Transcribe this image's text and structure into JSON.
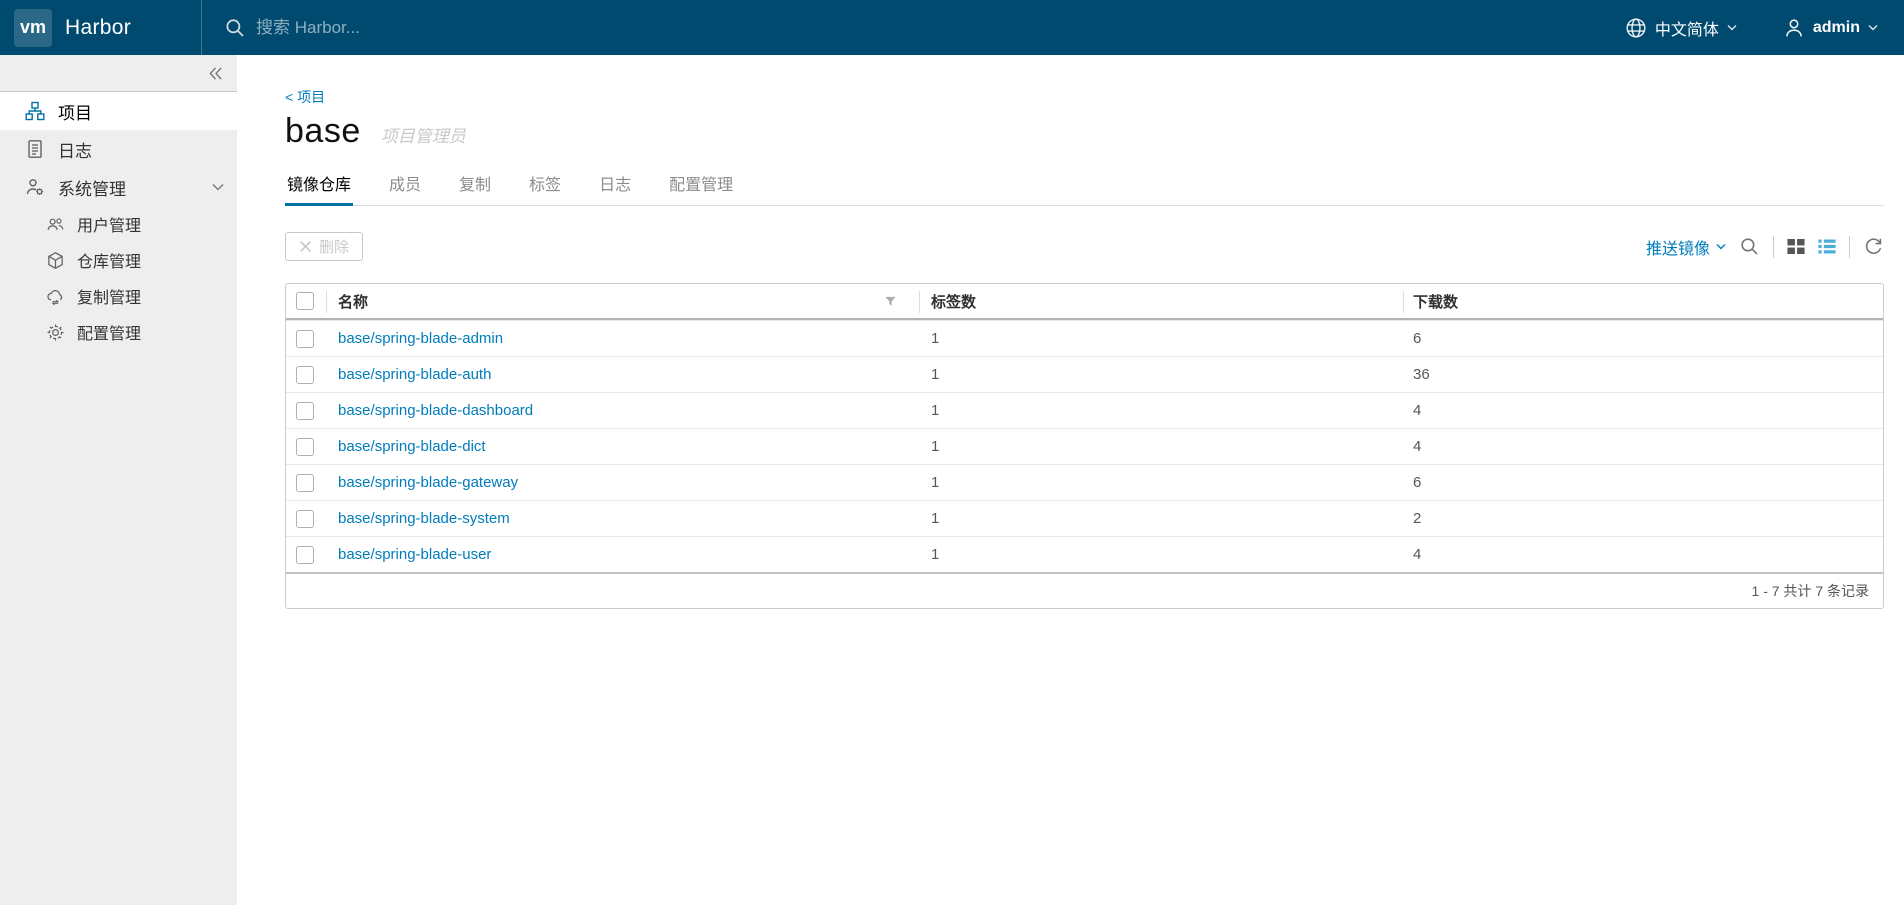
{
  "nav": {
    "logo_text": "vm",
    "brand": "Harbor",
    "search_placeholder": "搜索 Harbor...",
    "language": "中文简体",
    "username": "admin"
  },
  "sidebar": {
    "items": [
      {
        "label": "项目",
        "icon": "organization-icon",
        "active": true
      },
      {
        "label": "日志",
        "icon": "log-list-icon",
        "active": false
      },
      {
        "label": "系统管理",
        "icon": "administrator-icon",
        "active": false,
        "expanded": true
      }
    ],
    "subitems": [
      {
        "label": "用户管理",
        "icon": "users-icon"
      },
      {
        "label": "仓库管理",
        "icon": "cube-icon"
      },
      {
        "label": "复制管理",
        "icon": "replication-cloud-icon"
      },
      {
        "label": "配置管理",
        "icon": "gear-icon"
      }
    ]
  },
  "main": {
    "breadcrumb": "< 项目",
    "title": "base",
    "role_badge": "项目管理员",
    "tabs": [
      {
        "label": "镜像仓库",
        "active": true
      },
      {
        "label": "成员",
        "active": false
      },
      {
        "label": "复制",
        "active": false
      },
      {
        "label": "标签",
        "active": false
      },
      {
        "label": "日志",
        "active": false
      },
      {
        "label": "配置管理",
        "active": false
      }
    ],
    "toolbar": {
      "delete_label": "删除",
      "push_image_label": "推送镜像",
      "icons": [
        "search-icon",
        "grid-view-icon",
        "list-view-icon",
        "refresh-icon"
      ]
    },
    "table": {
      "columns": [
        "名称",
        "标签数",
        "下载数"
      ],
      "rows": [
        {
          "name": "base/spring-blade-admin",
          "tags": "1",
          "downloads": "6"
        },
        {
          "name": "base/spring-blade-auth",
          "tags": "1",
          "downloads": "36"
        },
        {
          "name": "base/spring-blade-dashboard",
          "tags": "1",
          "downloads": "4"
        },
        {
          "name": "base/spring-blade-dict",
          "tags": "1",
          "downloads": "4"
        },
        {
          "name": "base/spring-blade-gateway",
          "tags": "1",
          "downloads": "6"
        },
        {
          "name": "base/spring-blade-system",
          "tags": "1",
          "downloads": "2"
        },
        {
          "name": "base/spring-blade-user",
          "tags": "1",
          "downloads": "4"
        }
      ],
      "footer_summary": "1 - 7 共计 7 条记录"
    }
  },
  "colors": {
    "header_bg": "#004a70",
    "accent_blue": "#007cbb",
    "active_tab_underline": "#0072a3",
    "selected_view_icon": "#49afd9",
    "sidebar_bg": "#eeeeee"
  }
}
